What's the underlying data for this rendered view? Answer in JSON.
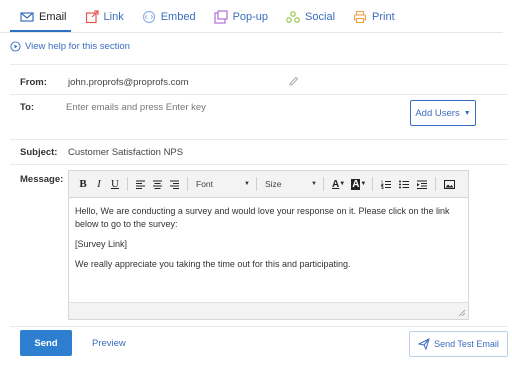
{
  "tabs": [
    {
      "label": "Email",
      "icon": "mail-icon",
      "active": true
    },
    {
      "label": "Link",
      "icon": "external-link-icon",
      "active": false
    },
    {
      "label": "Embed",
      "icon": "embed-icon",
      "active": false
    },
    {
      "label": "Pop-up",
      "icon": "popup-icon",
      "active": false
    },
    {
      "label": "Social",
      "icon": "social-icon",
      "active": false
    },
    {
      "label": "Print",
      "icon": "print-icon",
      "active": false
    }
  ],
  "help": {
    "label": "View help for this section"
  },
  "form": {
    "from_label": "From:",
    "from_value": "john.proprofs@proprofs.com",
    "to_label": "To:",
    "to_placeholder": "Enter emails and press Enter key",
    "add_users_label": "Add Users",
    "subject_label": "Subject:",
    "subject_value": "Customer Satisfaction NPS",
    "message_label": "Message:"
  },
  "toolbar": {
    "bold": "B",
    "italic": "I",
    "underline": "U",
    "font_label": "Font",
    "size_label": "Size",
    "font_color": "A",
    "bg_color": "A"
  },
  "message": {
    "paragraph1": "Hello, We are conducting a survey and would love your response on it. Please click on the link below to go to the survey:",
    "paragraph2": "[Survey Link]",
    "paragraph3": "We really appreciate you taking the time out for this and participating."
  },
  "actions": {
    "send_label": "Send",
    "preview_label": "Preview",
    "send_test_label": "Send Test Email"
  },
  "colors": {
    "accent": "#2f7fd0",
    "link": "#3a6dbf"
  }
}
